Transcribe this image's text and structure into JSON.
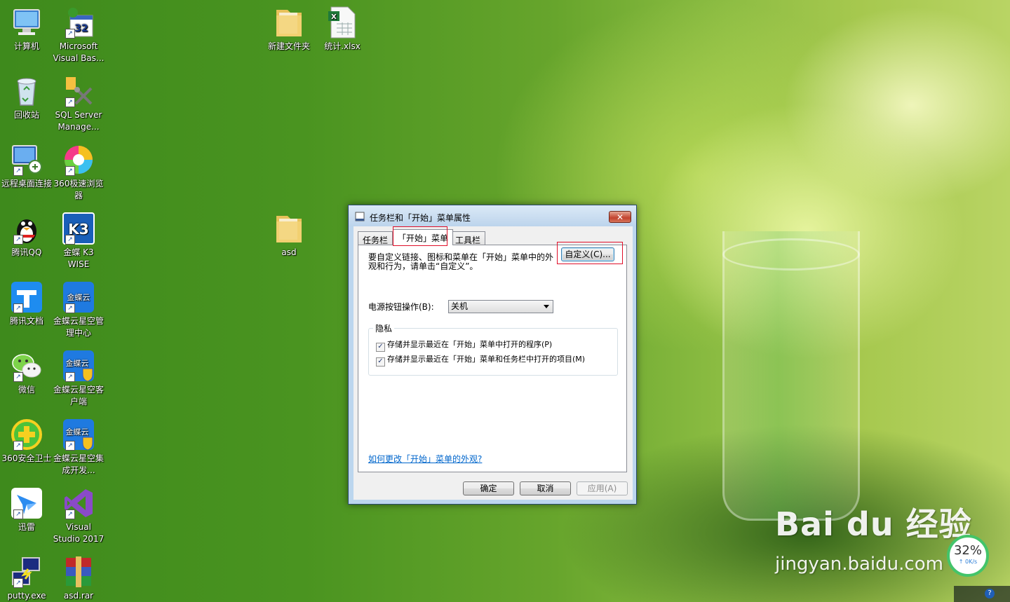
{
  "desktop": {
    "icons": [
      {
        "label": "计算机"
      },
      {
        "label": "Microsoft Visual Bas..."
      },
      {
        "label": "回收站"
      },
      {
        "label": "SQL Server Manage..."
      },
      {
        "label": "远程桌面连接"
      },
      {
        "label": "360极速浏览器"
      },
      {
        "label": "腾讯QQ"
      },
      {
        "label": "金蝶 K3 WISE"
      },
      {
        "label": "腾讯文档"
      },
      {
        "label": "金蝶云星空管理中心"
      },
      {
        "label": "微信"
      },
      {
        "label": "金蝶云星空客户端"
      },
      {
        "label": "360安全卫士"
      },
      {
        "label": "金蝶云星空集成开发..."
      },
      {
        "label": "迅雷"
      },
      {
        "label": "Visual Studio 2017"
      },
      {
        "label": "putty.exe"
      },
      {
        "label": "asd.rar"
      },
      {
        "label": "新建文件夹"
      },
      {
        "label": "统计.xlsx"
      },
      {
        "label": "asd"
      }
    ],
    "vb_badge": "32",
    "k3_glyph": "K3",
    "jdy_text": "金蝶云"
  },
  "dialog": {
    "title": "任务栏和「开始」菜单属性",
    "close_label": "✕",
    "tabs": [
      {
        "label": "任务栏"
      },
      {
        "label": "「开始」菜单"
      },
      {
        "label": "工具栏"
      }
    ],
    "description": "要自定义链接、图标和菜单在「开始」菜单中的外观和行为，请单击“自定义”。",
    "customize_button": "自定义(C)...",
    "power_label": "电源按钮操作(B):",
    "power_value": "关机",
    "privacy_title": "隐私",
    "checkboxes": [
      {
        "label": "存储并显示最近在「开始」菜单中打开的程序(P)",
        "checked": true
      },
      {
        "label": "存储并显示最近在「开始」菜单和任务栏中打开的项目(M)",
        "checked": true
      }
    ],
    "help_link": "如何更改「开始」菜单的外观?",
    "ok_button": "确定",
    "cancel_button": "取消",
    "apply_button": "应用(A)"
  },
  "watermark": {
    "logo": "Bai du 经验",
    "url": "jingyan.baidu.com"
  },
  "speed_widget": {
    "percent": "32%",
    "rate": "↑ 0K/s"
  },
  "tray": {
    "help_glyph": "?"
  }
}
